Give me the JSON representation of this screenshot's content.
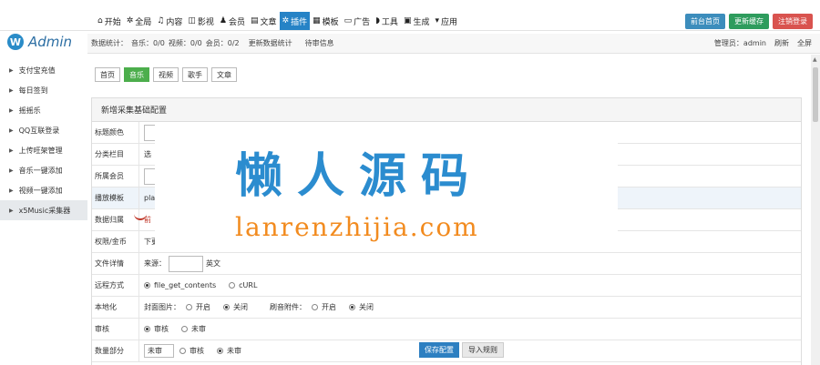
{
  "app": {
    "logo_text": "Admin",
    "logo_mark": "W"
  },
  "nav": [
    {
      "label": "开始",
      "icon": "home-icon",
      "glyph": "⌂"
    },
    {
      "label": "全局",
      "icon": "gear-icon",
      "glyph": "✲"
    },
    {
      "label": "内容",
      "icon": "music-icon",
      "glyph": "♫"
    },
    {
      "label": "影视",
      "icon": "film-icon",
      "glyph": "◫"
    },
    {
      "label": "会员",
      "icon": "user-icon",
      "glyph": "♟"
    },
    {
      "label": "文章",
      "icon": "file-icon",
      "glyph": "▤"
    },
    {
      "label": "插件",
      "icon": "plugin-icon",
      "glyph": "✲",
      "active": true
    },
    {
      "label": "模板",
      "icon": "template-icon",
      "glyph": "▦"
    },
    {
      "label": "广告",
      "icon": "monitor-icon",
      "glyph": "▭"
    },
    {
      "label": "工具",
      "icon": "shield-icon",
      "glyph": "◗"
    },
    {
      "label": "生成",
      "icon": "generate-icon",
      "glyph": "▣"
    },
    {
      "label": "应用",
      "icon": "app-icon",
      "glyph": "▾"
    }
  ],
  "top_buttons": {
    "front": "前台首页",
    "cache": "更新缓存",
    "logout": "注销登录"
  },
  "subbar": {
    "stats_label": "数据统计：",
    "music": "音乐：0/0",
    "video": "视频：0/0",
    "member": "会员：0/2",
    "update_stats": "更新数据统计",
    "pending": "待审信息",
    "admin": "管理员：admin",
    "refresh": "刷新",
    "fullscreen": "全屏"
  },
  "sidebar": [
    {
      "label": "支付宝充值"
    },
    {
      "label": "每日签到"
    },
    {
      "label": "摇摇乐"
    },
    {
      "label": "QQ互联登录"
    },
    {
      "label": "上传旺架管理"
    },
    {
      "label": "音乐一键添加"
    },
    {
      "label": "视频一键添加"
    },
    {
      "label": "x5Music采集器",
      "active": true
    }
  ],
  "tabs": [
    "首页",
    "音乐",
    "视频",
    "歌手",
    "文章"
  ],
  "panel": {
    "title": "新增采集基础配置",
    "rows": {
      "title_color": "标题颜色",
      "category": "分类栏目",
      "category_value": "选",
      "member": "所属会员",
      "template": "播放模板",
      "template_value": "pla",
      "source": "数据归属",
      "source_value": "前",
      "permission": "权限/金币",
      "permission_value": "下更",
      "lyrics": "文件详情",
      "lyrics_prefix": "来源：",
      "lyrics_suffix": "英文",
      "remote": "远程方式",
      "remote_opt1": "file_get_contents",
      "remote_opt2": "cURL",
      "localize": "本地化",
      "cover_label": "封面图片：",
      "on": "开启",
      "off": "关闭",
      "attach_label": "刷音附件：",
      "audit": "审核",
      "audited": "审核",
      "unaudited": "未审",
      "collect": "数量部分",
      "collect_v1": "未审",
      "collect_v2": "审核",
      "collect_v3": "未审"
    }
  },
  "watermark": {
    "cn": "懒人源码",
    "en": "lanrenzhijia.com"
  },
  "bottom_buttons": {
    "save": "保存配置",
    "import": "导入规则"
  },
  "colors": {
    "accent": "#2683c6",
    "active_tab": "#4cae4c",
    "danger": "#d9534f",
    "success": "#2e9c5d"
  }
}
